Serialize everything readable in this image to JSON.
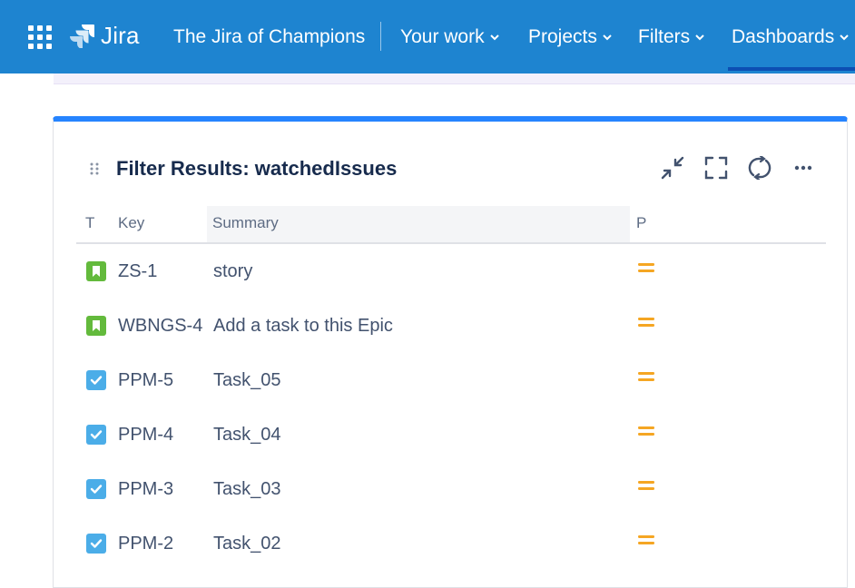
{
  "nav": {
    "brand": "Jira",
    "site_title": "The Jira of Champions",
    "items": [
      {
        "label": "Your work",
        "icon": "chevron-down-icon"
      },
      {
        "label": "Projects",
        "icon": "chevron-down-icon"
      },
      {
        "label": "Filters",
        "icon": "chevron-down-icon"
      },
      {
        "label": "Dashboards",
        "icon": "chevron-down-icon",
        "active": true
      }
    ]
  },
  "gadget": {
    "title": "Filter Results: watchedIssues",
    "actions": [
      "minimize-icon",
      "fullscreen-icon",
      "refresh-icon",
      "more-icon"
    ],
    "columns": {
      "type": "T",
      "key": "Key",
      "summary": "Summary",
      "priority": "P"
    },
    "rows": [
      {
        "type": "story",
        "key": "ZS-1",
        "summary": "story",
        "priority": "medium"
      },
      {
        "type": "story",
        "key": "WBNGS-4",
        "summary": "Add a task to this Epic",
        "priority": "medium"
      },
      {
        "type": "task",
        "key": "PPM-5",
        "summary": "Task_05",
        "priority": "medium"
      },
      {
        "type": "task",
        "key": "PPM-4",
        "summary": "Task_04",
        "priority": "medium"
      },
      {
        "type": "task",
        "key": "PPM-3",
        "summary": "Task_03",
        "priority": "medium"
      },
      {
        "type": "task",
        "key": "PPM-2",
        "summary": "Task_02",
        "priority": "medium"
      }
    ]
  },
  "colors": {
    "nav_bg": "#1e84d0",
    "gadget_accent": "#2684ff",
    "story": "#63ba3c",
    "task": "#4bade8",
    "priority_medium": "#f5a623"
  }
}
